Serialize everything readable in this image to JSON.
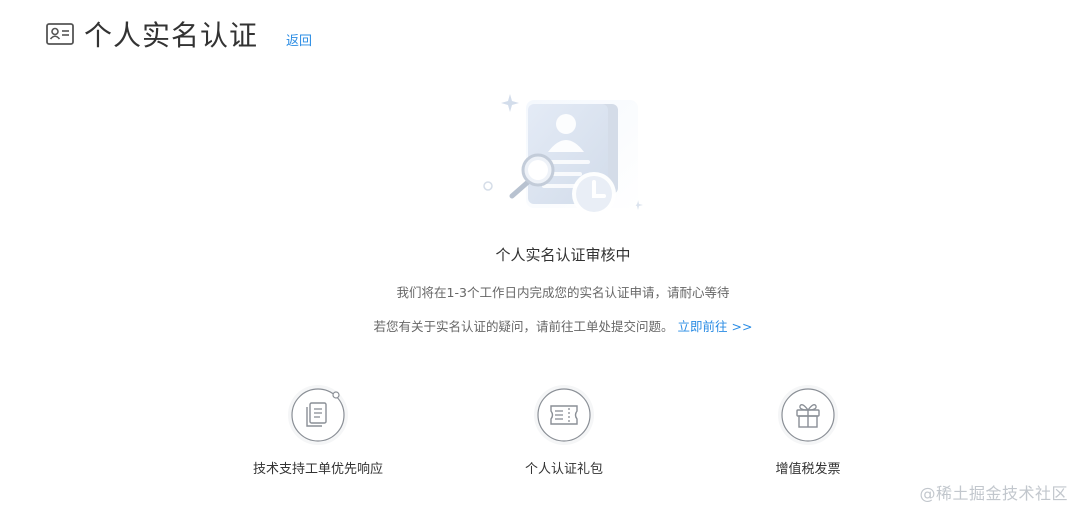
{
  "header": {
    "icon": "id-card-icon",
    "title": "个人实名认证",
    "back_label": "返回"
  },
  "status": {
    "illustration": "document-search-clock-illustration",
    "title": "个人实名认证审核中",
    "description": "我们将在1-3个工作日内完成您的实名认证申请，请耐心等待",
    "help_text": "若您有关于实名认证的疑问，请前往工单处提交问题。",
    "help_link": "立即前往 >>"
  },
  "features": [
    {
      "icon": "documents-icon",
      "label": "技术支持工单优先响应"
    },
    {
      "icon": "ticket-icon",
      "label": "个人认证礼包"
    },
    {
      "icon": "gift-icon",
      "label": "增值税发票"
    }
  ],
  "watermark": "@稀土掘金技术社区",
  "colors": {
    "accent": "#2a8ce4",
    "text": "#333333",
    "muted": "#666666",
    "icon_stroke": "#8a8f96"
  }
}
